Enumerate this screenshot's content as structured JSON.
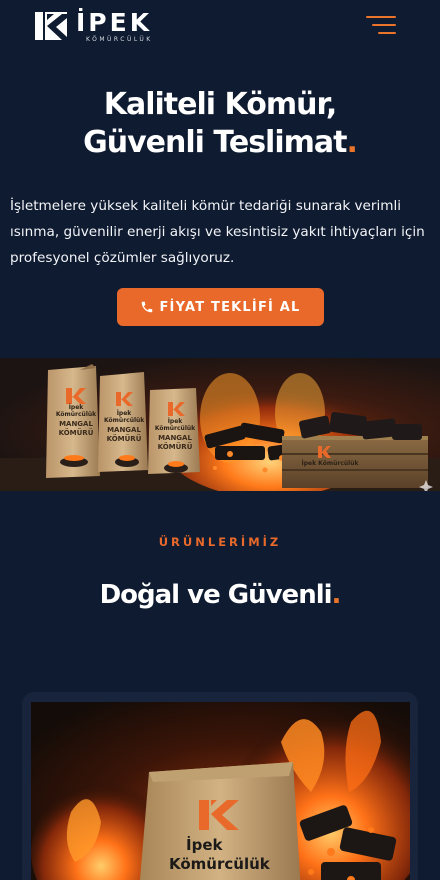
{
  "header": {
    "logo_word": "İPEK",
    "logo_sub": "KÖMÜRCÜLÜK",
    "menu_icon": "hamburger-menu-icon"
  },
  "hero": {
    "title_line1": "Kaliteli Kömür,",
    "title_line2": "Güvenli Teslimat",
    "title_dot": ".",
    "description": "İşletmelere yüksek kaliteli kömür tedariği sunarak verimli ısınma, güvenilir enerji akışı ve kesintisiz yakıt ihtiyaçları için profesyonel çözümler sağlıyoruz.",
    "cta_label": "FİYAT TEKLİFİ AL",
    "cta_icon": "phone-icon"
  },
  "banner": {
    "bag1_brand": "İpek Kömürcülük",
    "bag1_text": "MANGAL KÖMÜRÜ",
    "bag2_brand": "İpek Kömürcülük",
    "bag2_text": "MANGAL KÖMÜRÜ",
    "bag3_brand": "İpek Kömürcülük",
    "bag3_text": "MANGAL KÖMÜRÜ",
    "crate_text": "İpek Kömürcülük"
  },
  "products": {
    "label": "ÜRÜNLERİMİZ",
    "title": "Doğal ve Güvenli",
    "title_dot": ".",
    "card_bag_line1": "İpek",
    "card_bag_line2": "Kömürcülük"
  },
  "colors": {
    "background": "#0f1b30",
    "accent": "#e8692a",
    "card": "#17243b"
  }
}
